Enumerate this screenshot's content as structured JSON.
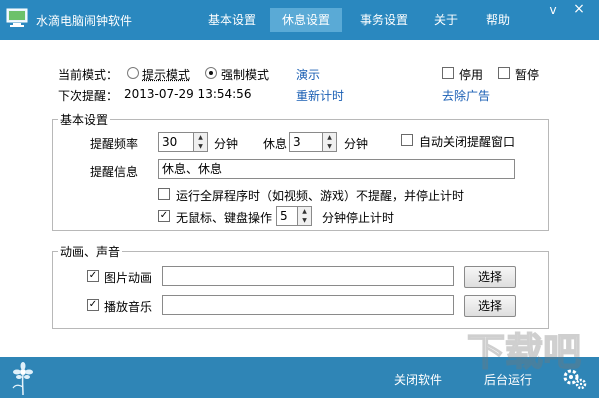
{
  "window": {
    "title": "水滴电脑闹钟软件",
    "minimize": "v",
    "close": "×"
  },
  "tabs": [
    {
      "label": "基本设置",
      "active": false
    },
    {
      "label": "休息设置",
      "active": true
    },
    {
      "label": "事务设置",
      "active": false
    },
    {
      "label": "关于",
      "active": false
    },
    {
      "label": "帮助",
      "active": false
    }
  ],
  "mode": {
    "label": "当前模式：",
    "option1": "提示模式",
    "option2": "强制模式",
    "selected": "强制模式",
    "demo": "演示",
    "disable": "停用",
    "pause": "暂停",
    "next_label": "下次提醒：",
    "next_time": "2013-07-29 13:54:56",
    "reset": "重新计时",
    "remove_ads": "去除广告"
  },
  "basic": {
    "legend": "基本设置",
    "freq_label": "提醒频率",
    "freq_value": "30",
    "unit": "分钟",
    "rest_label": "休息",
    "rest_value": "3",
    "auto_close": "自动关闭提醒窗口",
    "info_label": "提醒信息",
    "info_value": "休息、休息",
    "fullscreen": "运行全屏程序时（如视频、游戏）不提醒，并停止计时",
    "idle_label": "无鼠标、键盘操作",
    "idle_value": "5",
    "idle_suffix": "分钟停止计时"
  },
  "media": {
    "legend": "动画、声音",
    "image_label": "图片动画",
    "image_path": "",
    "music_label": "播放音乐",
    "music_path": "",
    "choose": "选择"
  },
  "footer": {
    "close_app": "关闭软件",
    "background_run": "后台运行"
  },
  "watermark": "下载吧",
  "colors": {
    "titlebar": "#2a88bf",
    "active_tab": "#5aaad6",
    "link": "#1a5fb4"
  }
}
